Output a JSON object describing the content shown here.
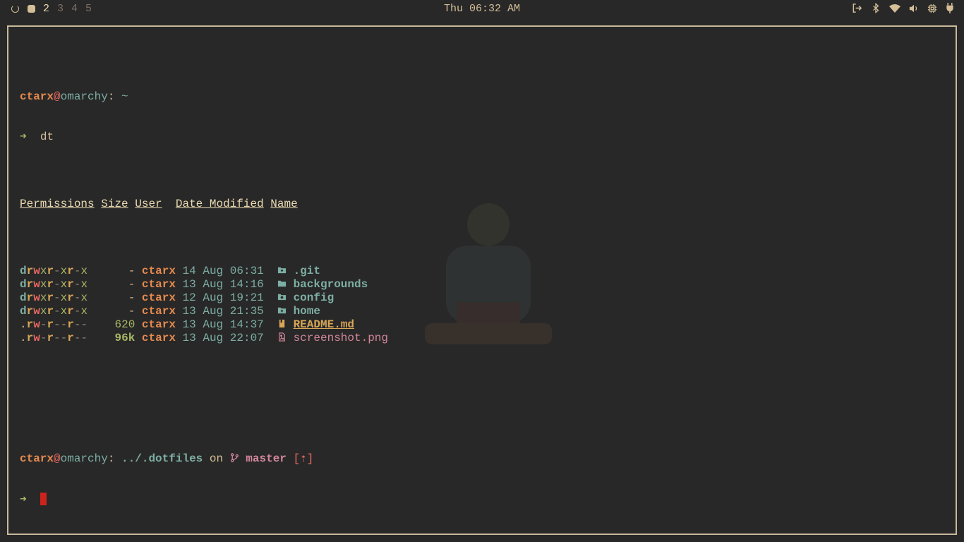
{
  "topbar": {
    "workspaces": [
      "2",
      "3",
      "4",
      "5"
    ],
    "current_workspace": "2",
    "clock": "Thu 06:32 AM",
    "tray_icons": [
      "logout-icon",
      "bluetooth-icon",
      "wifi-icon",
      "volume-icon",
      "cpu-icon",
      "power-plug-icon"
    ]
  },
  "terminal": {
    "prompt1": {
      "user": "ctarx",
      "at": "@",
      "host": "omarchy",
      "sep": ": ",
      "path": "~"
    },
    "command": "dt",
    "arrow": "➜",
    "headers": {
      "permissions": "Permissions",
      "size": "Size",
      "user": "User",
      "date": "Date Modified",
      "name": "Name"
    },
    "rows": [
      {
        "perm": "drwxr-xr-x",
        "size": "-",
        "user": "ctarx",
        "date": "14 Aug 06:31",
        "icon": "git-folder-icon",
        "name": ".git",
        "kind": "dir"
      },
      {
        "perm": "drwxr-xr-x",
        "size": "-",
        "user": "ctarx",
        "date": "13 Aug 14:16",
        "icon": "folder-icon",
        "name": "backgrounds",
        "kind": "dir"
      },
      {
        "perm": "drwxr-xr-x",
        "size": "-",
        "user": "ctarx",
        "date": "12 Aug 19:21",
        "icon": "config-folder-icon",
        "name": "config",
        "kind": "dir"
      },
      {
        "perm": "drwxr-xr-x",
        "size": "-",
        "user": "ctarx",
        "date": "13 Aug 21:35",
        "icon": "home-folder-icon",
        "name": "home",
        "kind": "dir"
      },
      {
        "perm": ".rw-r--r--",
        "size": "620",
        "user": "ctarx",
        "date": "13 Aug 14:37",
        "icon": "readme-icon",
        "name": "README.md",
        "kind": "readme"
      },
      {
        "perm": ".rw-r--r--",
        "size": "96k",
        "user": "ctarx",
        "date": "13 Aug 22:07",
        "icon": "image-file-icon",
        "name": "screenshot.png",
        "kind": "img"
      }
    ],
    "prompt2": {
      "user": "ctarx",
      "at": "@",
      "host": "omarchy",
      "sep": ": ",
      "path": "../.dotfiles",
      "on": "on",
      "branch": "master",
      "status": "[⇡]"
    }
  },
  "colors": {
    "background": "#282828",
    "border": "#c9b99a",
    "user": "#e78a4e",
    "dir": "#7daea3",
    "readme": "#d8a657",
    "image": "#d3869b",
    "cursor": "#cc241d"
  }
}
